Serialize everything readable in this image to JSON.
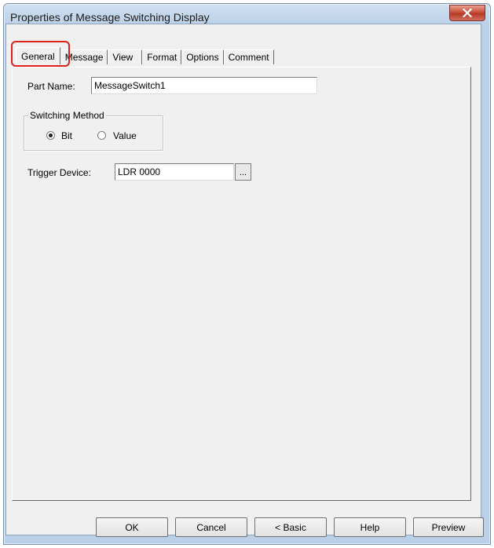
{
  "window": {
    "title": "Properties of Message Switching Display"
  },
  "tabs": [
    {
      "label": "General"
    },
    {
      "label": "Message"
    },
    {
      "label": "View"
    },
    {
      "label": "Format"
    },
    {
      "label": "Options"
    },
    {
      "label": "Comment"
    }
  ],
  "general": {
    "part_name_label": "Part Name:",
    "part_name_value": "MessageSwitch1",
    "switching_method_label": "Switching Method",
    "bit_label": "Bit",
    "value_label": "Value",
    "selected_method": "Bit",
    "trigger_device_label": "Trigger Device:",
    "trigger_device_value": "LDR 0000",
    "browse_label": "..."
  },
  "buttons": {
    "ok": "OK",
    "cancel": "Cancel",
    "basic": "< Basic",
    "help": "Help",
    "preview": "Preview"
  },
  "colors": {
    "highlight": "#e0201b",
    "titlebar": "#b9d0e8",
    "close_button": "#c8523d"
  }
}
